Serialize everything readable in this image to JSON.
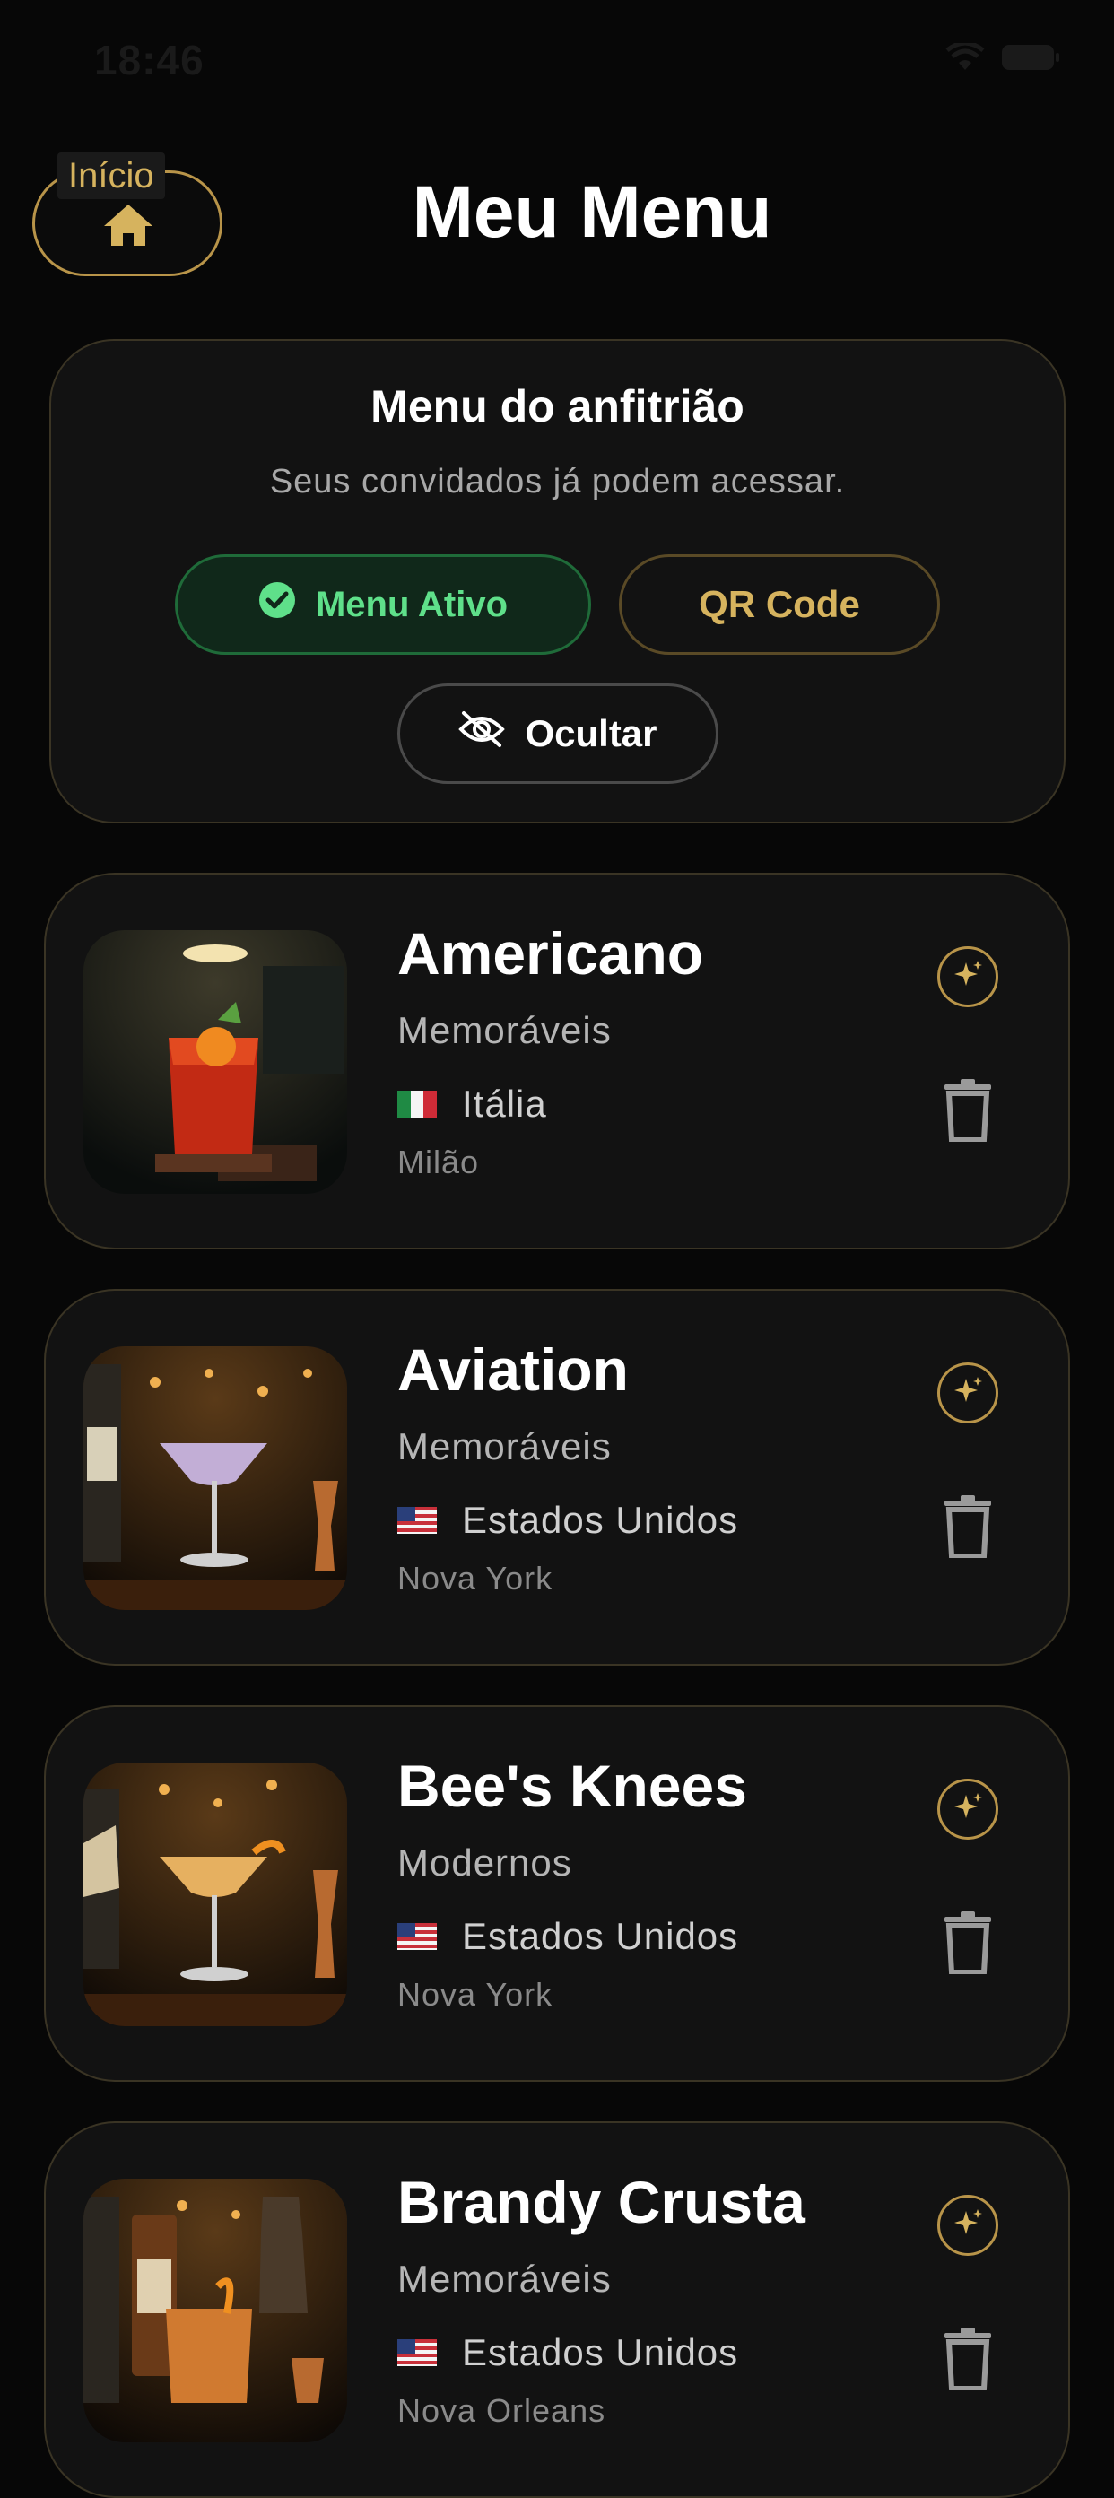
{
  "status_bar": {
    "time": "18:46"
  },
  "header": {
    "home_label": "Início",
    "title": "Meu Menu"
  },
  "host_panel": {
    "title": "Menu do anfitrião",
    "subtitle": "Seus convidados já podem acessar.",
    "active_label": "Menu Ativo",
    "qr_label": "QR Code",
    "hide_label": "Ocultar"
  },
  "colors": {
    "background": "#070707",
    "card": "#121212",
    "accent_gold": "#d6b35e",
    "active_green": "#5fe08a"
  },
  "drinks": [
    {
      "name": "Americano",
      "category": "Memoráveis",
      "country": "Itália",
      "flag": "italy-flag",
      "city": "Milão"
    },
    {
      "name": "Aviation",
      "category": "Memoráveis",
      "country": "Estados Unidos",
      "flag": "usa-flag",
      "city": "Nova York"
    },
    {
      "name": "Bee's Knees",
      "category": "Modernos",
      "country": "Estados Unidos",
      "flag": "usa-flag",
      "city": "Nova York"
    },
    {
      "name": "Brandy Crusta",
      "category": "Memoráveis",
      "country": "Estados Unidos",
      "flag": "usa-flag",
      "city": "Nova Orleans"
    }
  ]
}
